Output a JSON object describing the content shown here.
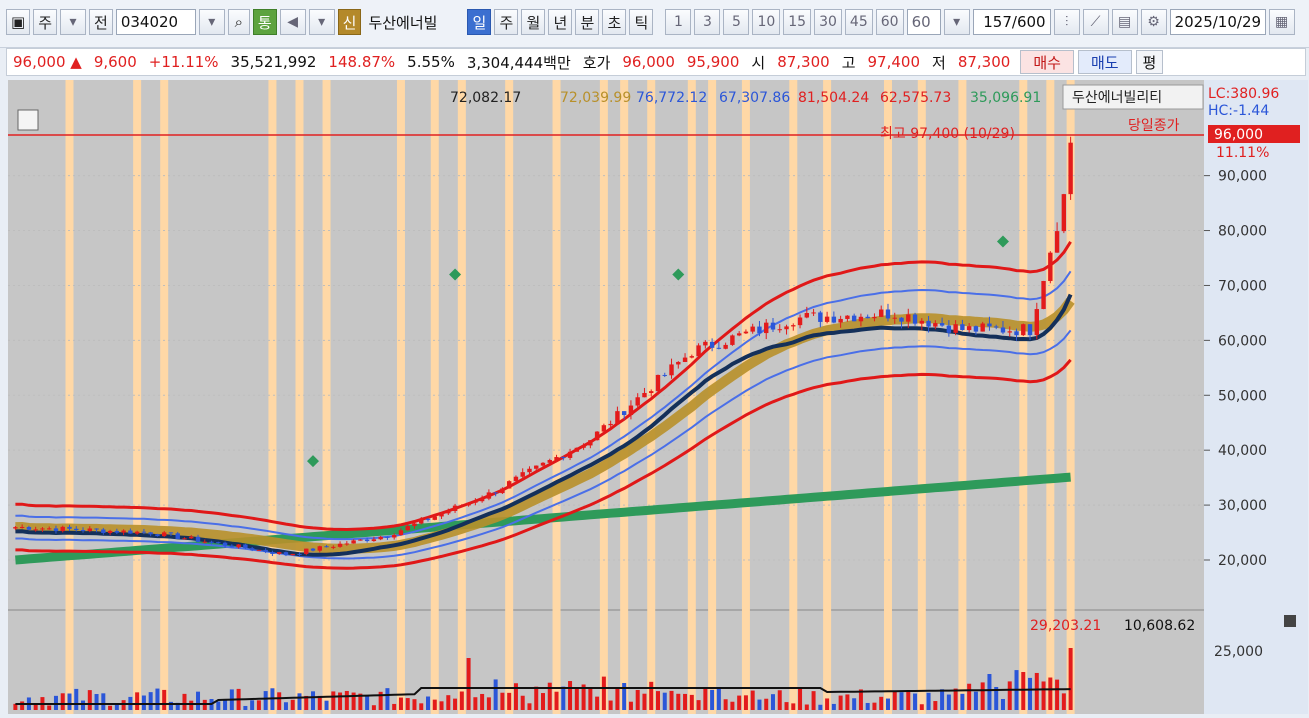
{
  "toolbar": {
    "type_label": "주",
    "jeon_label": "전",
    "code": "034020",
    "tong_label": "통",
    "shin_label": "신",
    "stock_name": "두산에너빌",
    "periods": [
      "일",
      "주",
      "월",
      "년",
      "분",
      "초",
      "틱"
    ],
    "active_period": "일",
    "intervals": [
      "1",
      "3",
      "5",
      "10",
      "15",
      "30",
      "45",
      "60"
    ],
    "interval_input": "60",
    "count": "157",
    "count_total": "/600",
    "date": "2025/10/29"
  },
  "quote": {
    "price": "96,000",
    "change": "9,600",
    "change_pct": "+11.11%",
    "volume": "35,521,992",
    "vol_ratio": "148.87%",
    "turnover": "5.55%",
    "amount": "3,304,444백만",
    "hoga_label": "호가",
    "ask": "96,000",
    "bid": "95,900",
    "open_label": "시",
    "open": "87,300",
    "high_label": "고",
    "high": "97,400",
    "low_label": "저",
    "low": "87,300",
    "buy_label": "매수",
    "sell_label": "매도",
    "avg_label": "평"
  },
  "legend": {
    "ma1": "72,082.17",
    "ma2": "72,039.99",
    "bb_upper_inner": "76,772.12",
    "bb_lower_inner": "67,307.86",
    "bb_upper_outer": "81,504.24",
    "bb_lower_outer": "62,575.73",
    "ma_long": "35,096.91",
    "name": "두산에너빌리티"
  },
  "annotations": {
    "lc": "LC:380.96",
    "hc": "HC:-1.44",
    "high_marker": "최고 97,400 (10/29)",
    "close_label": "당일종가",
    "last_price": "96,000",
    "last_pct": "11.11%"
  },
  "volume_legend": {
    "v1": "29,203.21",
    "v2": "10,608.62"
  },
  "colors": {
    "up": "#e31b1b",
    "down": "#2b56d8",
    "band_outer": "#e01818",
    "band_inner": "#4a6fe8",
    "ma_gold": "#b8902a",
    "ma_navy": "#14305a",
    "ma_green": "#2e9a5a",
    "highlight": "#ffd8a6",
    "plot_bg": "#c6c6c6"
  },
  "chart_data": {
    "type": "candlestick",
    "ylim": [
      14000,
      100000
    ],
    "y_ticks": [
      "90,000",
      "80,000",
      "70,000",
      "60,000",
      "50,000",
      "40,000",
      "30,000",
      "20,000"
    ],
    "volume_tick": "25,000",
    "candles": 157,
    "approx_path": [
      [
        0,
        26000
      ],
      [
        20,
        25000
      ],
      [
        40,
        21000
      ],
      [
        55,
        24500
      ],
      [
        70,
        32000
      ],
      [
        85,
        42000
      ],
      [
        100,
        58000
      ],
      [
        115,
        64000
      ],
      [
        130,
        65000
      ],
      [
        140,
        62000
      ],
      [
        150,
        62000
      ],
      [
        157,
        96000
      ]
    ]
  }
}
